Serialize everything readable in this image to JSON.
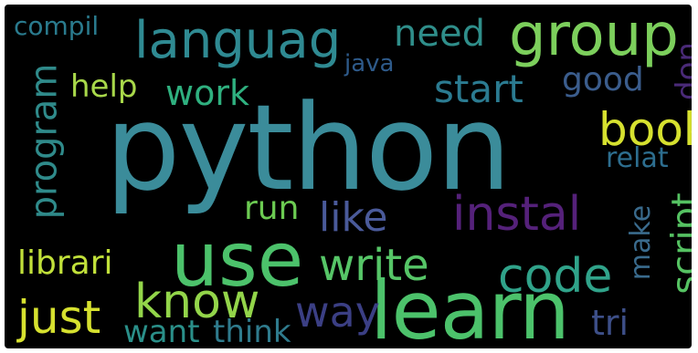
{
  "palette": {
    "background": "#000000",
    "python": "#3b8c9a",
    "learn": "#4cc26b",
    "use": "#4cc26b",
    "languag": "#2f8a92",
    "group": "#7ccf5c",
    "compil": "#2a7b8e",
    "need": "#2f8e8a",
    "don": "#4a2a78",
    "java": "#2e5a8a",
    "program": "#2f8a8a",
    "help": "#a8d84a",
    "work": "#2fb07f",
    "start": "#2b7b91",
    "good": "#3b5d8d",
    "book": "#d6e12f",
    "relat": "#2d6e8f",
    "run": "#6ccb52",
    "like": "#4a5a9a",
    "instal": "#55217a",
    "script": "#55c262",
    "make": "#3a6b8d",
    "librari": "#c1e03a",
    "write": "#56c567",
    "code": "#30a38a",
    "know": "#93d54a",
    "just": "#d6e12f",
    "way": "#3b3f84",
    "tri": "#3d4f88",
    "want": "#2a8f89",
    "think": "#2f7b8d"
  },
  "words": {
    "python": "python",
    "use": "use",
    "learn": "learn",
    "languag": "languag",
    "group": "group",
    "compil": "compil",
    "need": "need",
    "don": "don",
    "java": "java",
    "program": "program",
    "help": "help",
    "work": "work",
    "start": "start",
    "good": "good",
    "book": "book",
    "relat": "relat",
    "run": "run",
    "like": "like",
    "instal": "instal",
    "script": "script",
    "make": "make",
    "librari": "librari",
    "write": "write",
    "code": "code",
    "know": "know",
    "just": "just",
    "way": "way",
    "tri": "tri",
    "want": "want",
    "think": "think"
  }
}
